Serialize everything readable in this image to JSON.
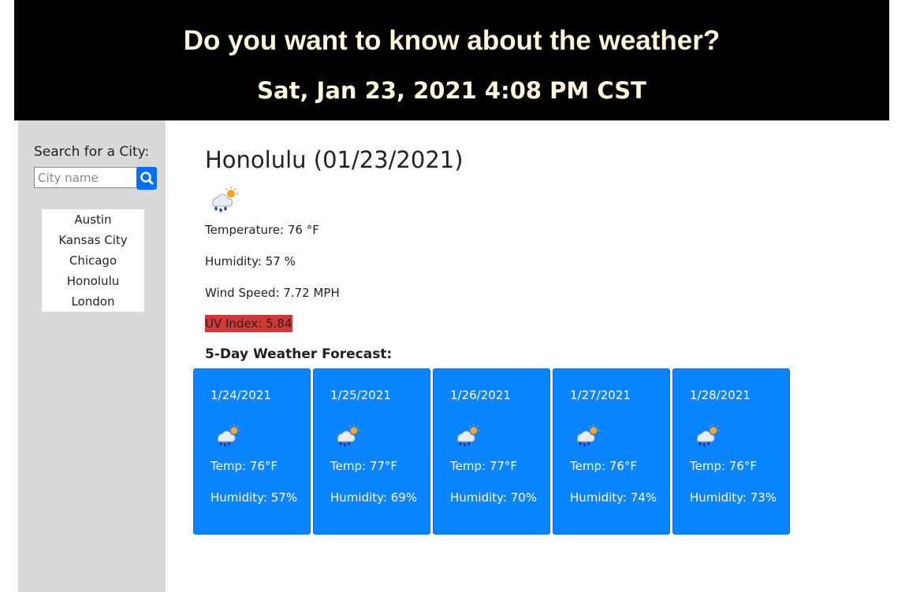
{
  "header": {
    "title": "Do you want to know about the weather?",
    "datetime": "Sat, Jan 23, 2021 4:08 PM CST"
  },
  "sidebar": {
    "search_label": "Search for a City:",
    "search_placeholder": "City name",
    "search_value": "",
    "search_icon": "search-icon",
    "history": [
      "Austin",
      "Kansas City",
      "Chicago",
      "Honolulu",
      "London"
    ]
  },
  "current": {
    "title": "Honolulu (01/23/2021)",
    "icon": "rain-sun-icon",
    "temperature": "Temperature: 76 °F",
    "humidity": "Humidity: 57 %",
    "wind": "Wind Speed: 7.72 MPH",
    "uv": "UV Index: 5.84",
    "uv_color": "#d13838"
  },
  "forecast": {
    "title": "5-Day Weather Forecast:",
    "card_color": "#0a84ff",
    "days": [
      {
        "date": "1/24/2021",
        "icon": "rain-sun-icon",
        "temp": "Temp: 76°F",
        "humidity": "Humidity: 57%"
      },
      {
        "date": "1/25/2021",
        "icon": "rain-sun-icon",
        "temp": "Temp: 77°F",
        "humidity": "Humidity: 69%"
      },
      {
        "date": "1/26/2021",
        "icon": "rain-sun-icon",
        "temp": "Temp: 77°F",
        "humidity": "Humidity: 70%"
      },
      {
        "date": "1/27/2021",
        "icon": "rain-sun-icon",
        "temp": "Temp: 76°F",
        "humidity": "Humidity: 74%"
      },
      {
        "date": "1/28/2021",
        "icon": "rain-sun-icon",
        "temp": "Temp: 76°F",
        "humidity": "Humidity: 73%"
      }
    ]
  }
}
